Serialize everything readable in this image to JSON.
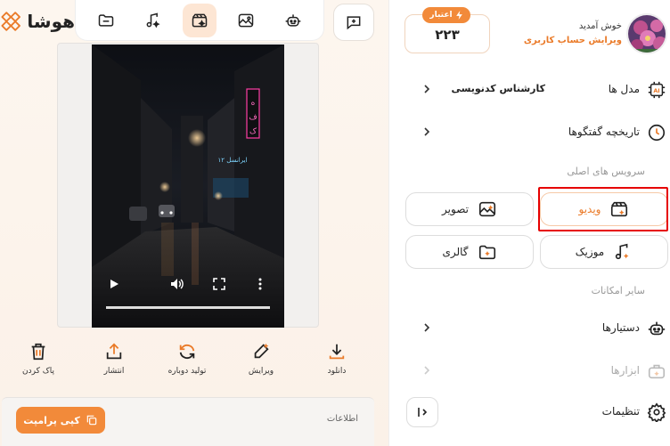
{
  "brand": {
    "name": "هوشا"
  },
  "toolbar": {
    "items": [
      {
        "icon": "folder-icon"
      },
      {
        "icon": "music-icon"
      },
      {
        "icon": "video-clapper-icon",
        "active": true
      },
      {
        "icon": "image-icon"
      },
      {
        "icon": "robot-icon"
      }
    ],
    "new_chat_icon": "chat-plus-icon"
  },
  "actions": [
    {
      "label": "دانلود",
      "icon": "download-icon"
    },
    {
      "label": "ویرایش",
      "icon": "edit-icon"
    },
    {
      "label": "تولید دوباره",
      "icon": "regenerate-icon"
    },
    {
      "label": "انتشار",
      "icon": "share-icon"
    },
    {
      "label": "پاک کردن",
      "icon": "trash-icon"
    }
  ],
  "video": {
    "sign_text": "ک ف ه",
    "shop_text": "ایرانسل ۱۲",
    "progress": 1.0
  },
  "info": {
    "title": "اطلاعات",
    "copy_label": "کپی پرامپت"
  },
  "credit": {
    "badge": "اعتبار",
    "value": "۲۲۳"
  },
  "user": {
    "greeting": "خوش آمدید",
    "edit_account": "ویرایش حساب کاربری"
  },
  "menu": {
    "models": {
      "label": "مدل ها",
      "value": "کارشناس کدنویسی"
    },
    "history": {
      "label": "تاریخچه گفتگوها"
    }
  },
  "main_services": {
    "title": "سرویس های اصلی",
    "items": [
      {
        "label": "ویدیو",
        "icon": "video-clapper-icon",
        "active": true
      },
      {
        "label": "تصویر",
        "icon": "image-icon"
      },
      {
        "label": "موزیک",
        "icon": "music-icon"
      },
      {
        "label": "گالری",
        "icon": "gallery-icon"
      }
    ]
  },
  "other": {
    "title": "سایر امکانات",
    "assistants": "دستیارها",
    "tools": "ابزارها",
    "settings": "تنظیمات"
  },
  "colors": {
    "accent": "#f28a3a",
    "highlight": "#e60000",
    "accent_bg": "#fde6d4"
  }
}
